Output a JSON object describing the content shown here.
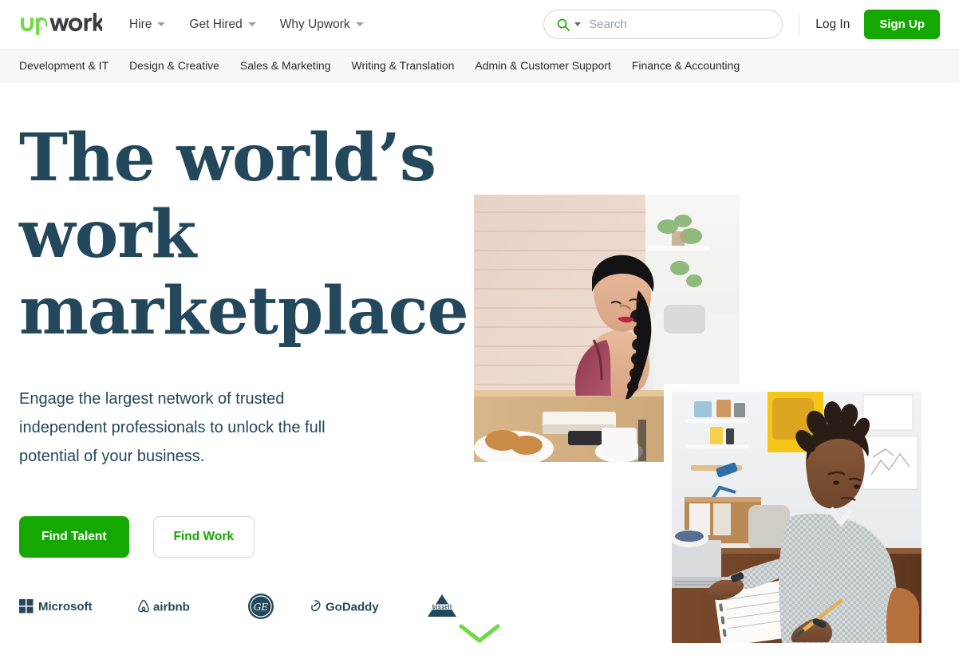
{
  "header": {
    "logo_text": "Upwork",
    "logo_icon": "upwork-logo",
    "nav": [
      {
        "label": "Hire",
        "icon": "chevron-down-icon"
      },
      {
        "label": "Get Hired",
        "icon": "chevron-down-icon"
      },
      {
        "label": "Why Upwork",
        "icon": "chevron-down-icon"
      }
    ],
    "search": {
      "icon": "search-icon",
      "dropdown_icon": "chevron-down-icon",
      "placeholder": "Search",
      "value": ""
    },
    "login_label": "Log In",
    "signup_label": "Sign Up"
  },
  "categories": [
    "Development & IT",
    "Design & Creative",
    "Sales & Marketing",
    "Writing & Translation",
    "Admin & Customer Support",
    "Finance & Accounting"
  ],
  "hero": {
    "headline_line1": "The world’s work",
    "headline_line2": "marketplace",
    "subhead": "Engage the largest network of trusted independent professionals to unlock the full potential of your business.",
    "primary_cta": "Find Talent",
    "secondary_cta": "Find Work",
    "image_top": "woman-working-at-table-photo",
    "image_bottom": "man-writing-notebook-photo",
    "scroll_icon": "chevron-down-icon"
  },
  "brands": [
    {
      "name": "Microsoft",
      "icon": "microsoft-logo"
    },
    {
      "name": "airbnb",
      "icon": "airbnb-logo"
    },
    {
      "name": "GE",
      "icon": "ge-logo"
    },
    {
      "name": "GoDaddy",
      "icon": "godaddy-logo"
    },
    {
      "name": "BISSELL",
      "icon": "bissell-logo"
    }
  ],
  "colors": {
    "brand_green": "#14a800",
    "accent_green": "#6fda44",
    "headline_navy": "#23485b",
    "logo_dark": "#3c3c3c",
    "catbar_bg": "#f7f7f7"
  }
}
